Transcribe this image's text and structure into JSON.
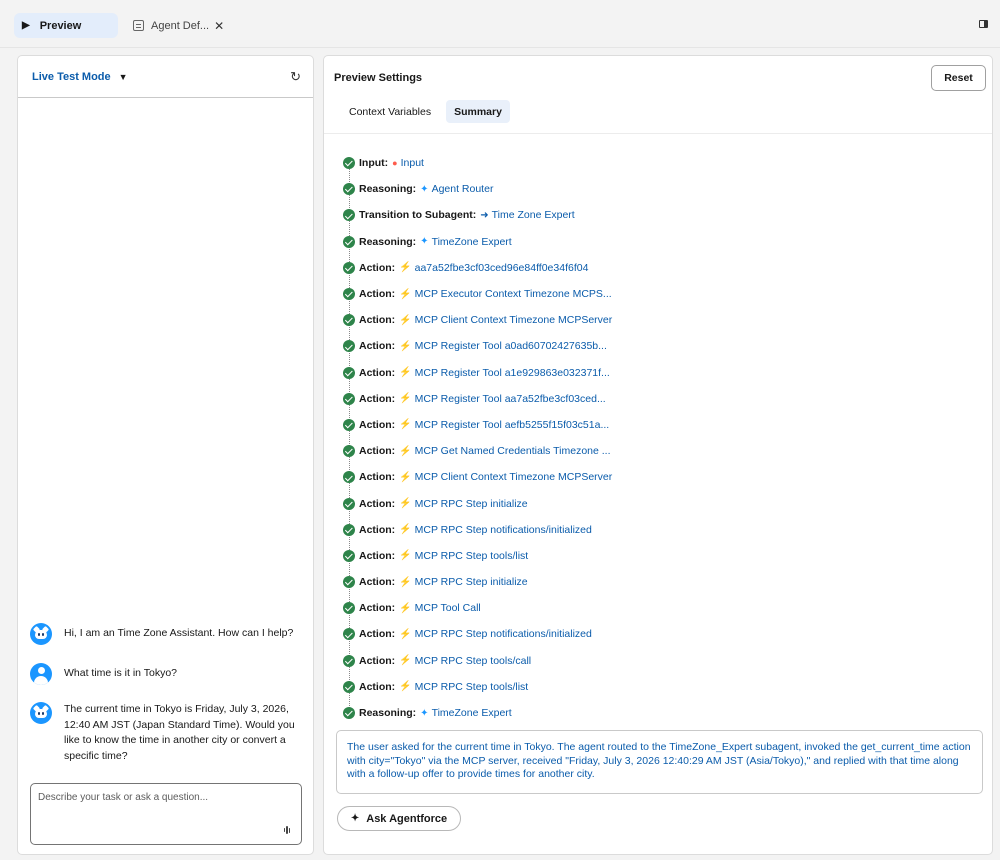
{
  "tabs": [
    {
      "label": "Preview",
      "icon": "play-icon"
    },
    {
      "label": "Agent Def...",
      "icon": "document-icon"
    }
  ],
  "left_panel": {
    "mode_label": "Live Test Mode",
    "messages": [
      {
        "role": "agent",
        "text": "Hi, I am an Time Zone Assistant. How can I help?"
      },
      {
        "role": "user",
        "text": "What time is it in Tokyo?"
      },
      {
        "role": "agent",
        "text": "The current time in Tokyo is Friday, July 3, 2026, 12:40 AM JST (Japan Standard Time). Would you like to know the time in another city or convert a specific time?"
      }
    ],
    "composer_placeholder": "Describe your task or ask a question..."
  },
  "right_panel": {
    "title": "Preview Settings",
    "reset_label": "Reset",
    "subtabs": [
      "Context Variables",
      "Summary"
    ],
    "active_subtab": "Summary",
    "steps": [
      {
        "label": "Input:",
        "type": "input",
        "link": "Input"
      },
      {
        "label": "Reasoning:",
        "type": "reasoning",
        "link": "Agent Router"
      },
      {
        "label": "Transition to Subagent:",
        "type": "transition",
        "link": "Time Zone Expert"
      },
      {
        "label": "Reasoning:",
        "type": "reasoning",
        "link": "TimeZone Expert"
      },
      {
        "label": "Action:",
        "type": "action",
        "link": "aa7a52fbe3cf03ced96e84ff0e34f6f04"
      },
      {
        "label": "Action:",
        "type": "action",
        "link": "MCP Executor Context Timezone MCPS..."
      },
      {
        "label": "Action:",
        "type": "action",
        "link": "MCP Client Context Timezone MCPServer"
      },
      {
        "label": "Action:",
        "type": "action",
        "link": "MCP Register Tool a0ad60702427635b..."
      },
      {
        "label": "Action:",
        "type": "action",
        "link": "MCP Register Tool a1e929863e032371f..."
      },
      {
        "label": "Action:",
        "type": "action",
        "link": "MCP Register Tool aa7a52fbe3cf03ced..."
      },
      {
        "label": "Action:",
        "type": "action",
        "link": "MCP Register Tool aefb5255f15f03c51a..."
      },
      {
        "label": "Action:",
        "type": "action",
        "link": "MCP Get Named Credentials Timezone ..."
      },
      {
        "label": "Action:",
        "type": "action",
        "link": "MCP Client Context Timezone MCPServer"
      },
      {
        "label": "Action:",
        "type": "action",
        "link": "MCP RPC Step initialize"
      },
      {
        "label": "Action:",
        "type": "action",
        "link": "MCP RPC Step notifications/initialized"
      },
      {
        "label": "Action:",
        "type": "action",
        "link": "MCP RPC Step tools/list"
      },
      {
        "label": "Action:",
        "type": "action",
        "link": "MCP RPC Step initialize"
      },
      {
        "label": "Action:",
        "type": "action",
        "link": "MCP Tool Call"
      },
      {
        "label": "Action:",
        "type": "action",
        "link": "MCP RPC Step notifications/initialized"
      },
      {
        "label": "Action:",
        "type": "action",
        "link": "MCP RPC Step tools/call"
      },
      {
        "label": "Action:",
        "type": "action",
        "link": "MCP RPC Step tools/list"
      },
      {
        "label": "Reasoning:",
        "type": "reasoning",
        "link": "TimeZone Expert"
      }
    ],
    "summary": "The user asked for the current time in Tokyo. The agent routed to the TimeZone_Expert subagent, invoked the get_current_time action with city=\"Tokyo\" via the MCP server, received \"Friday, July 3, 2026 12:40:29 AM JST (Asia/Tokyo),\" and replied with that time along with a follow-up offer to provide times for another city.",
    "ask_button": "Ask Agentforce"
  },
  "colors": {
    "accent": "#0b5cab",
    "success": "#2e844a",
    "action": "#f5a623",
    "reasoning": "#1b96ff",
    "input": "#fe5c4c"
  }
}
